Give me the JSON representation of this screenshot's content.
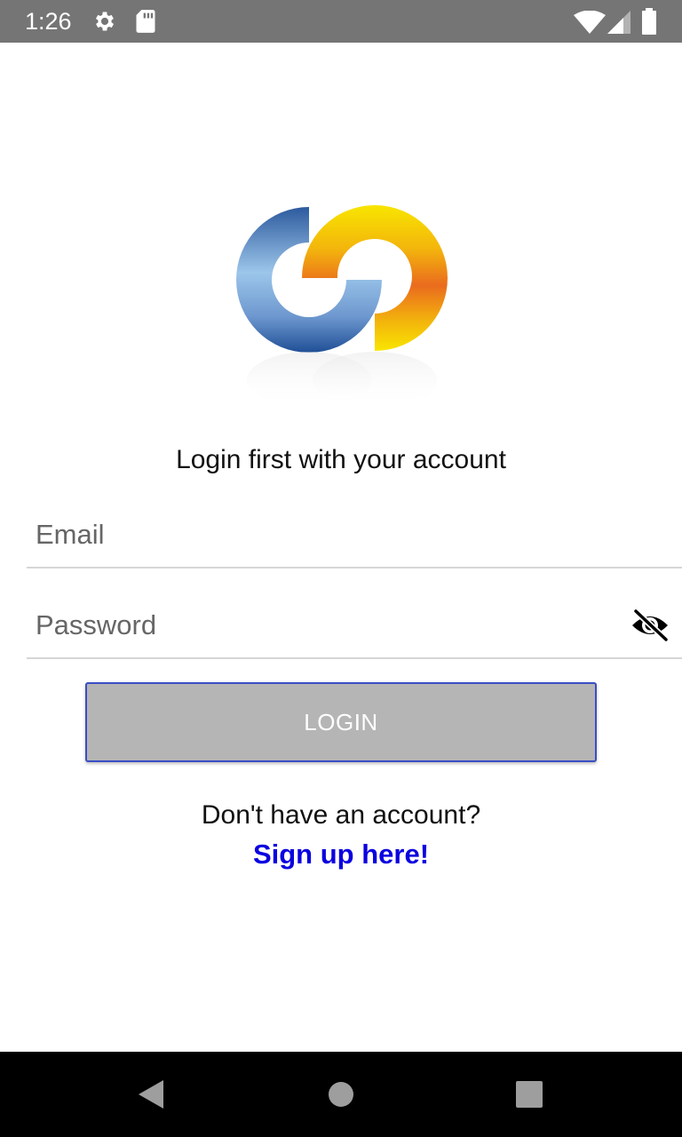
{
  "status_bar": {
    "time": "1:26",
    "icons": [
      "settings-icon",
      "sd-card-icon",
      "wifi-icon",
      "signal-icon",
      "battery-icon"
    ]
  },
  "logo": {
    "icon": "app-logo-interlocked-rings",
    "colors": {
      "blue_light": "#9cc6ea",
      "blue_dark": "#1f4f96",
      "yellow": "#f8e500",
      "orange": "#ea6b1e"
    }
  },
  "login": {
    "heading": "Login first with your account",
    "email_placeholder": "Email",
    "password_placeholder": "Password",
    "eye_icon": "visibility-off-icon",
    "button_label": "LOGIN",
    "button_color": "#b5b5b5",
    "button_border_color": "#3a4ec4"
  },
  "signup": {
    "prompt": "Don't have an account?",
    "link_label": "Sign up here!",
    "link_color": "#0b00e0"
  },
  "nav_bar": {
    "icons": [
      "back-icon",
      "home-icon",
      "recents-icon"
    ]
  }
}
